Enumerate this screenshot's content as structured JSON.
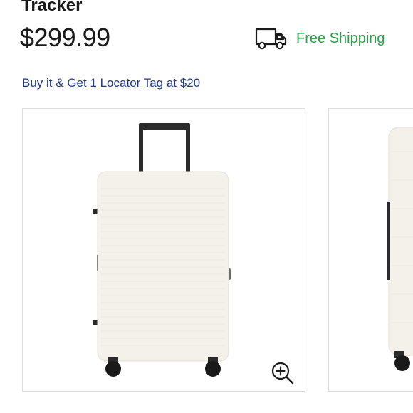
{
  "product": {
    "title": "Tracker",
    "price": "$299.99"
  },
  "shipping": {
    "label": "Free Shipping",
    "icon": "truck-icon",
    "color": "#2aa04a"
  },
  "promo": {
    "link_text": "Buy it & Get 1 Locator Tag at $20",
    "color": "#1f3a8a"
  },
  "gallery": {
    "images": [
      {
        "name": "white-suitcase-front"
      },
      {
        "name": "white-suitcase-side"
      }
    ],
    "zoom_icon": "zoom-in-icon"
  }
}
